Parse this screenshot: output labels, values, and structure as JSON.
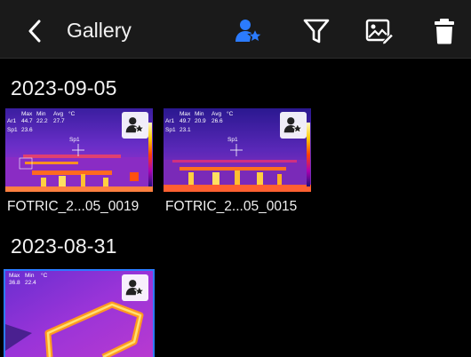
{
  "header": {
    "title": "Gallery",
    "icons": [
      "back-chevron-icon",
      "favorite-user-star-icon",
      "filter-funnel-icon",
      "edit-image-icon",
      "trash-icon"
    ],
    "accent": "#2b7bff"
  },
  "sections": [
    {
      "date": "2023-09-05",
      "items": [
        {
          "caption": "FOTRIC_2...05_0019",
          "labels": [
            "Max",
            "Min",
            "Avg",
            "°C"
          ],
          "ar1_label": "Ar1",
          "ar1": [
            "44.7",
            "22.2",
            "27.7"
          ],
          "sp1_label": "Sp1",
          "sp1": "23.6",
          "sp_marker": "Sp1"
        },
        {
          "caption": "FOTRIC_2...05_0015",
          "labels": [
            "Max",
            "Min",
            "Avg",
            "°C"
          ],
          "ar1_label": "Ar1",
          "ar1": [
            "49.7",
            "20.9",
            "26.6"
          ],
          "sp1_label": "Sp1",
          "sp1": "23.1",
          "sp_marker": "Sp1"
        }
      ]
    },
    {
      "date": "2023-08-31",
      "items": [
        {
          "labels": [
            "Max",
            "Min",
            "°C"
          ],
          "values": [
            "36.8",
            "22.4"
          ]
        }
      ]
    }
  ]
}
